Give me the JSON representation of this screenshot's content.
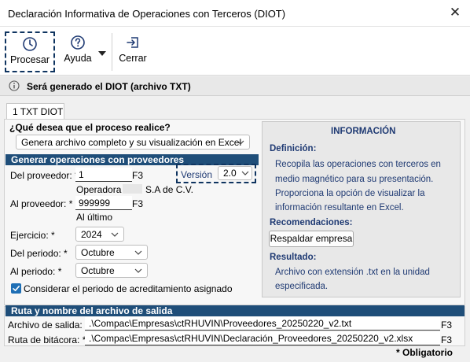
{
  "window": {
    "title": "Declaración Informativa de Operaciones con Terceros (DIOT)",
    "close_glyph": "✕"
  },
  "toolbar": {
    "procesar": "Procesar",
    "ayuda": "Ayuda",
    "cerrar": "Cerrar"
  },
  "info_banner": {
    "message": "Será generado el DIOT (archivo TXT)"
  },
  "tabs": [
    {
      "label": "1 TXT DIOT"
    }
  ],
  "process": {
    "question": "¿Qué desea que el proceso realice?",
    "selected_option": "Genera archivo completo y su visualización en Excel"
  },
  "providers_section": {
    "title": "Generar operaciones con proveedores",
    "from_label": "Del proveedor: *",
    "from_value": "1",
    "from_key": "F3",
    "from_name": "Operadora",
    "from_name_suffix": "S.A de C.V.",
    "version_label": "Versión",
    "version_value": "2.0",
    "to_label": "Al proveedor: *",
    "to_value": "999999",
    "to_key": "F3",
    "to_name": "Al último",
    "year_label": "Ejercicio: *",
    "year_value": "2024",
    "period_from_label": "Del periodo: *",
    "period_from_value": "Octubre",
    "period_to_label": "Al periodo: *",
    "period_to_value": "Octubre",
    "checkbox_label": "Considerar el periodo de acreditamiento asignado",
    "checkbox_checked": true
  },
  "info_panel": {
    "heading": "INFORMACIÓN",
    "definition_label": "Definición:",
    "definition_lines": [
      "Recopila las operaciones con terceros  en",
      "medio magnético para su presentación.",
      "Proporciona la opción de visualizar la",
      "información resultante en Excel."
    ],
    "recommendations_label": "Recomendaciones:",
    "backup_button": "Respaldar empresa",
    "result_label": "Resultado:",
    "result_lines": [
      "Archivo con extensión .txt en la unidad",
      "especificada."
    ]
  },
  "output_section": {
    "title": "Ruta y nombre del archivo de salida",
    "output_label": "Archivo de salida: *",
    "output_path": ".\\Compac\\Empresas\\ctRHUVIN\\Proveedores_20250220_v2.txt",
    "output_key": "F3",
    "log_label": "Ruta de bitácora: *",
    "log_path": ".\\Compac\\Empresas\\ctRHUVIN\\Declaración_Proveedores_20250220_v2.xlsx",
    "log_key": "F3"
  },
  "footer": {
    "required_note": "* Obligatorio"
  },
  "colors": {
    "section_bar": "#1f4e79",
    "info_text": "#1f3a73",
    "focus_dash": "#0f3460",
    "checkbox": "#1f6fb5"
  }
}
